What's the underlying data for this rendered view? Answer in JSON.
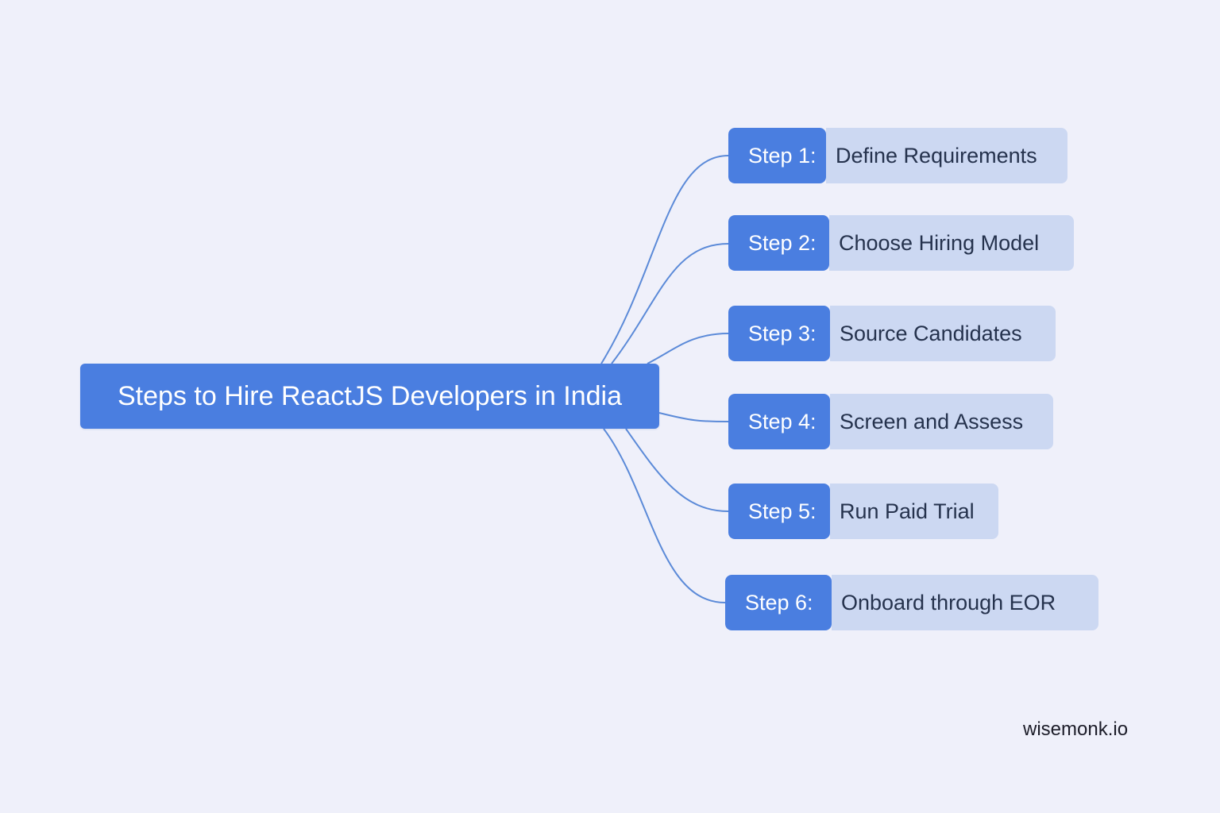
{
  "diagram": {
    "root_title": "Steps to Hire ReactJS Developers in India",
    "steps": [
      {
        "number": "Step 1:",
        "label": "Define Requirements"
      },
      {
        "number": "Step 2:",
        "label": "Choose Hiring Model"
      },
      {
        "number": "Step 3:",
        "label": "Source Candidates"
      },
      {
        "number": "Step 4:",
        "label": "Screen and Assess"
      },
      {
        "number": "Step 5:",
        "label": "Run Paid Trial"
      },
      {
        "number": "Step 6:",
        "label": "Onboard through EOR"
      }
    ]
  },
  "footer": {
    "brand": "wisemonk.io"
  },
  "colors": {
    "background": "#eff0fa",
    "node_primary": "#4a7ee0",
    "node_secondary": "#ccd8f2",
    "connector": "#5b8ad8",
    "label_text": "#25324d"
  }
}
